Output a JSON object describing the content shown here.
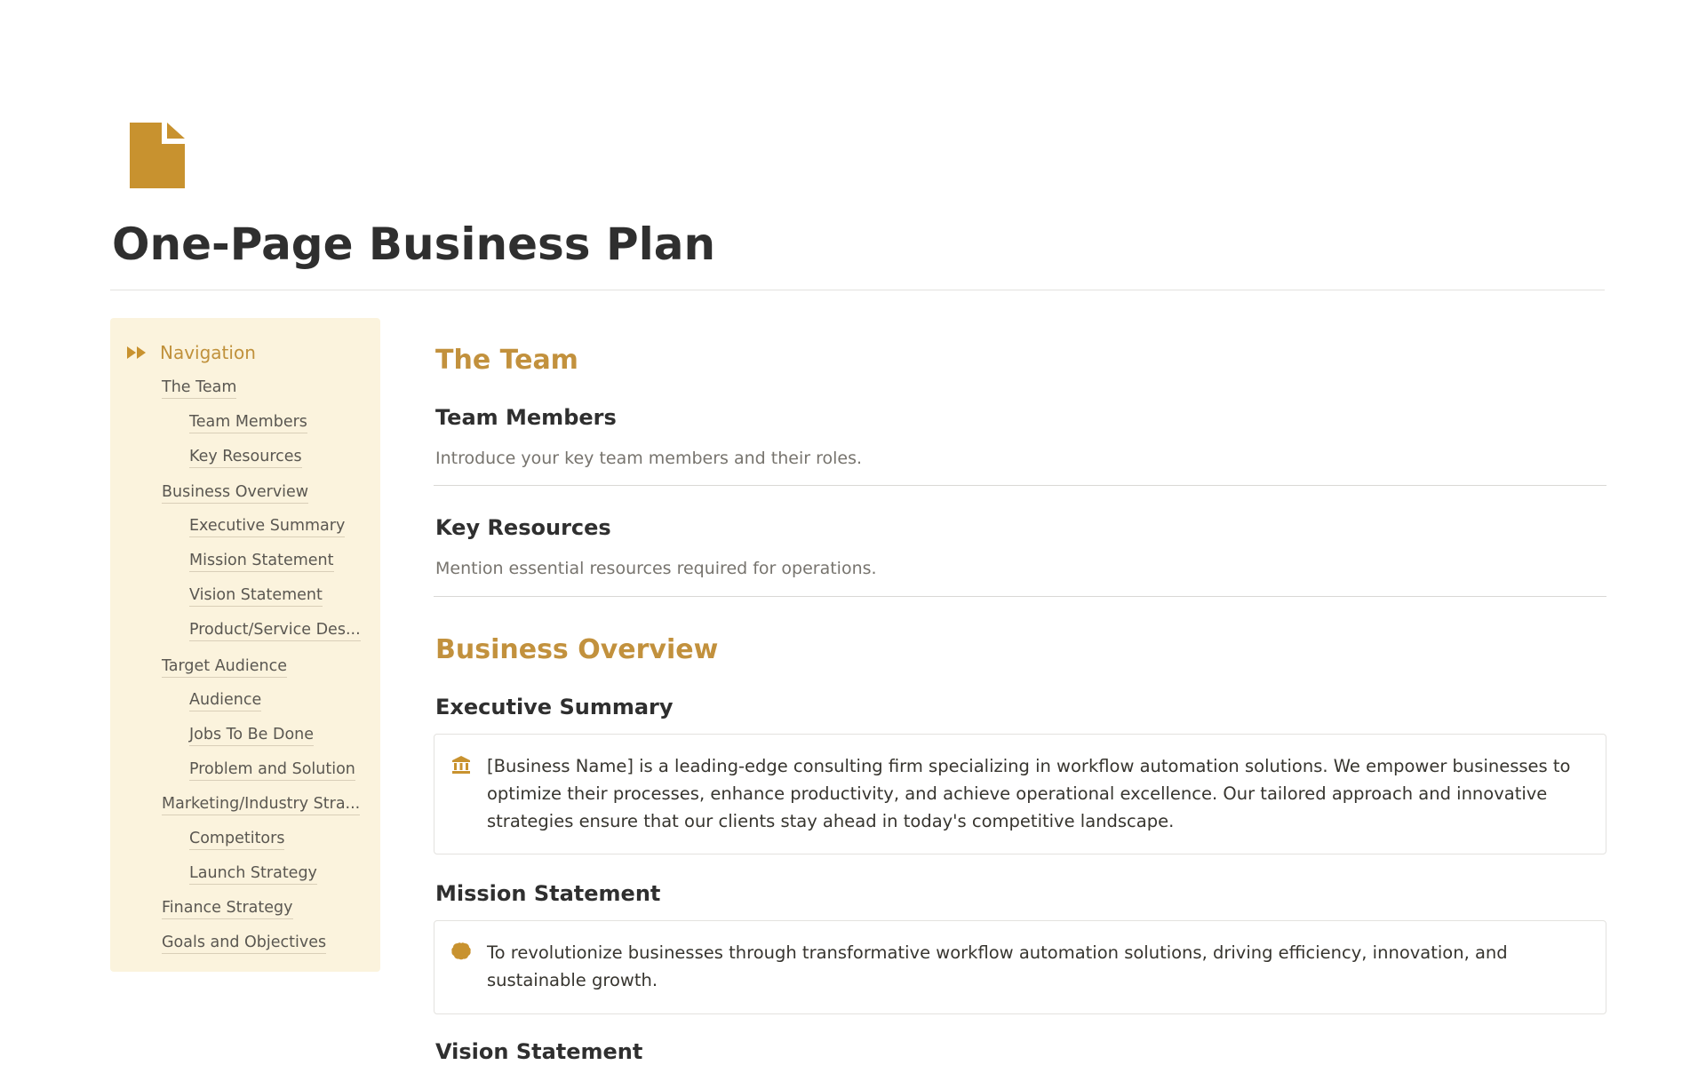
{
  "page": {
    "title": "One-Page Business Plan",
    "icon": "document-icon",
    "accent_color": "#c8922f"
  },
  "sidebar": {
    "header": "Navigation",
    "header_icon": "fast-forward-icon",
    "background": "#fbf3dd",
    "items": [
      {
        "label": "The Team",
        "level": 1
      },
      {
        "label": "Team Members",
        "level": 2
      },
      {
        "label": "Key Resources",
        "level": 2
      },
      {
        "label": "Business Overview",
        "level": 1
      },
      {
        "label": "Executive Summary",
        "level": 2
      },
      {
        "label": "Mission Statement",
        "level": 2
      },
      {
        "label": "Vision Statement",
        "level": 2
      },
      {
        "label": "Product/Service Des...",
        "level": 2
      },
      {
        "label": "Target Audience",
        "level": 1
      },
      {
        "label": "Audience",
        "level": 2
      },
      {
        "label": "Jobs To Be Done",
        "level": 2
      },
      {
        "label": "Problem and Solution",
        "level": 2
      },
      {
        "label": "Marketing/Industry Stra...",
        "level": 1
      },
      {
        "label": "Competitors",
        "level": 2
      },
      {
        "label": "Launch Strategy",
        "level": 2
      },
      {
        "label": "Finance Strategy",
        "level": 1
      },
      {
        "label": "Goals and Objectives",
        "level": 1
      }
    ]
  },
  "main": {
    "team": {
      "heading": "The Team",
      "members_heading": "Team Members",
      "members_desc": "Introduce your key team members and their roles.",
      "resources_heading": "Key Resources",
      "resources_desc": "Mention essential resources required for operations."
    },
    "overview": {
      "heading": "Business Overview",
      "executive_heading": "Executive Summary",
      "executive_icon": "bank-icon",
      "executive_text": "[Business Name] is a leading-edge consulting firm specializing in workflow automation solutions. We empower businesses to optimize their processes, enhance productivity, and achieve operational excellence. Our tailored approach and innovative strategies ensure that our clients stay ahead in today's competitive landscape.",
      "mission_heading": "Mission Statement",
      "mission_icon": "brain-icon",
      "mission_text": "To revolutionize businesses through transformative workflow automation solutions, driving efficiency, innovation, and sustainable growth.",
      "vision_heading": "Vision Statement"
    }
  }
}
